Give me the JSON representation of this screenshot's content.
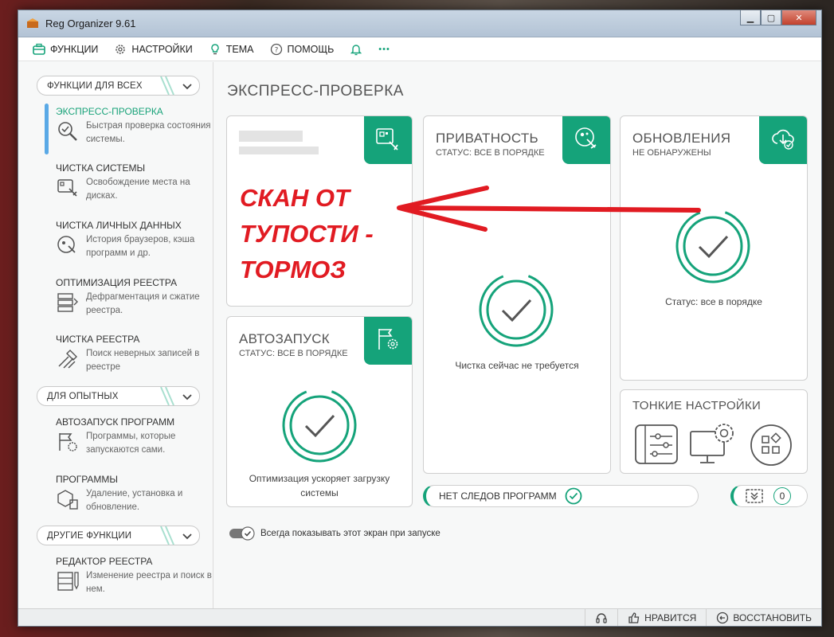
{
  "window": {
    "title": "Reg Organizer 9.61"
  },
  "menu": {
    "functions": "ФУНКЦИИ",
    "settings": "НАСТРОЙКИ",
    "theme": "ТЕМА",
    "help": "ПОМОЩЬ",
    "more": "•••"
  },
  "sidebar": {
    "sections": [
      {
        "label": "ФУНКЦИИ ДЛЯ ВСЕХ"
      },
      {
        "label": "ДЛЯ ОПЫТНЫХ"
      },
      {
        "label": "ДРУГИЕ ФУНКЦИИ"
      }
    ],
    "items": [
      {
        "title": "ЭКСПРЕСС-ПРОВЕРКА",
        "desc": "Быстрая проверка состояния системы."
      },
      {
        "title": "ЧИСТКА СИСТЕМЫ",
        "desc": "Освобождение места на дисках."
      },
      {
        "title": "ЧИСТКА ЛИЧНЫХ ДАННЫХ",
        "desc": "История браузеров, кэша программ и др."
      },
      {
        "title": "ОПТИМИЗАЦИЯ РЕЕСТРА",
        "desc": "Дефрагментация и сжатие реестра."
      },
      {
        "title": "ЧИСТКА РЕЕСТРА",
        "desc": "Поиск неверных записей в реестре"
      },
      {
        "title": "АВТОЗАПУСК ПРОГРАММ",
        "desc": "Программы, которые запускаются сами."
      },
      {
        "title": "ПРОГРАММЫ",
        "desc": "Удаление, установка и обновление."
      },
      {
        "title": "РЕДАКТОР РЕЕСТРА",
        "desc": "Изменение реестра и поиск в нем."
      }
    ]
  },
  "content": {
    "page_title": "ЭКСПРЕСС-ПРОВЕРКА",
    "annotation": [
      "СКАН ОТ",
      "ТУПОСТИ -",
      "ТОРМОЗ"
    ],
    "privacy": {
      "title": "ПРИВАТНОСТЬ",
      "status": "СТАТУС: ВСЕ В ПОРЯДКЕ",
      "message": "Чистка сейчас не требуется"
    },
    "updates": {
      "title": "ОБНОВЛЕНИЯ",
      "status": "НЕ ОБНАРУЖЕНЫ",
      "message": "Статус: все в порядке"
    },
    "autorun": {
      "title": "АВТОЗАПУСК",
      "status": "СТАТУС: ВСЕ В ПОРЯДКЕ",
      "message": "Оптимизация ускоряет загрузку системы"
    },
    "tweaks": {
      "title": "ТОНКИЕ НАСТРОЙКИ"
    },
    "no_traces": {
      "label": "НЕТ СЛЕДОВ ПРОГРАММ"
    },
    "counter": {
      "value": "0"
    },
    "always_show": "Всегда показывать этот экран при запуске"
  },
  "statusbar": {
    "like": "НРАВИТСЯ",
    "restore": "ВОССТАНОВИТЬ"
  },
  "colors": {
    "accent": "#15a37a",
    "annotation": "#e11b22",
    "active_indicator": "#5aa9e6"
  }
}
